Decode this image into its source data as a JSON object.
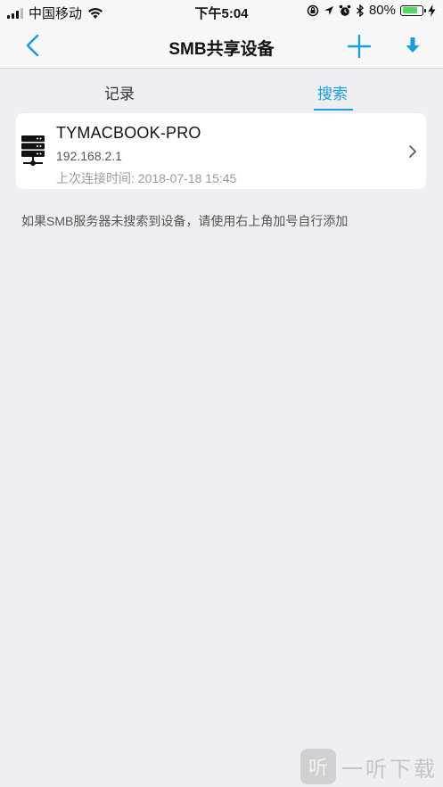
{
  "status_bar": {
    "carrier": "中国移动",
    "time": "下午5:04",
    "battery_percent": "80%",
    "battery_level": 0.8
  },
  "nav": {
    "title": "SMB共享设备",
    "back_icon": "chevron-left-icon",
    "add_icon": "plus-icon",
    "download_icon": "download-arrow-icon",
    "accent_color": "#1a9ce0"
  },
  "tabs": [
    {
      "label": "记录",
      "active": false
    },
    {
      "label": "搜索",
      "active": true
    }
  ],
  "devices": [
    {
      "name": "TYMACBOOK-PRO",
      "ip": "192.168.2.1",
      "last_connected": "上次连接时间:  2018-07-18 15:45",
      "icon": "server-icon"
    }
  ],
  "hint": "如果SMB服务器未搜索到设备，请使用右上角加号自行添加",
  "watermark": {
    "badge": "听",
    "text": "一听下载"
  }
}
